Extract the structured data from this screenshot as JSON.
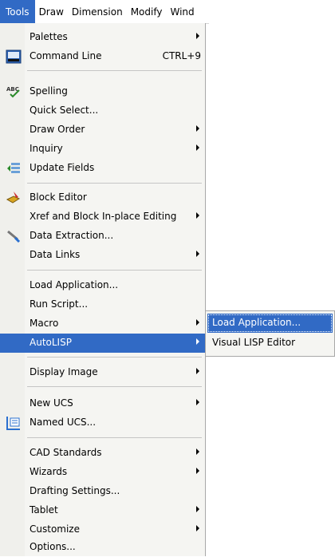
{
  "menubar": {
    "items": [
      "Tools",
      "Draw",
      "Dimension",
      "Modify",
      "Wind"
    ]
  },
  "menu": {
    "items": [
      {
        "label": "Palettes",
        "submenu": true
      },
      {
        "label": "Command Line",
        "shortcut": "CTRL+9",
        "icon": "command-line-icon"
      },
      {
        "label": "Spelling",
        "icon": "spelling-icon"
      },
      {
        "label": "Quick Select..."
      },
      {
        "label": "Draw Order",
        "submenu": true
      },
      {
        "label": "Inquiry",
        "submenu": true
      },
      {
        "label": "Update Fields",
        "icon": "update-fields-icon"
      },
      {
        "label": "Block Editor",
        "icon": "block-editor-icon"
      },
      {
        "label": "Xref and Block In-place Editing",
        "submenu": true
      },
      {
        "label": "Data Extraction...",
        "icon": "data-extraction-icon"
      },
      {
        "label": "Data Links",
        "submenu": true
      },
      {
        "label": "Load Application..."
      },
      {
        "label": "Run Script..."
      },
      {
        "label": "Macro",
        "submenu": true
      },
      {
        "label": "AutoLISP",
        "submenu": true,
        "highlighted": true
      },
      {
        "label": "Display Image",
        "submenu": true
      },
      {
        "label": "New UCS",
        "submenu": true
      },
      {
        "label": "Named UCS...",
        "icon": "named-ucs-icon"
      },
      {
        "label": "CAD Standards",
        "submenu": true
      },
      {
        "label": "Wizards",
        "submenu": true
      },
      {
        "label": "Drafting Settings..."
      },
      {
        "label": "Tablet",
        "submenu": true
      },
      {
        "label": "Customize",
        "submenu": true
      },
      {
        "label": "Options..."
      }
    ]
  },
  "submenu": {
    "items": [
      {
        "label": "Load Application...",
        "highlighted": true
      },
      {
        "label": "Visual LISP Editor"
      }
    ]
  },
  "colors": {
    "highlight": "#316ac5",
    "menu_bg": "#f5f5f2"
  }
}
